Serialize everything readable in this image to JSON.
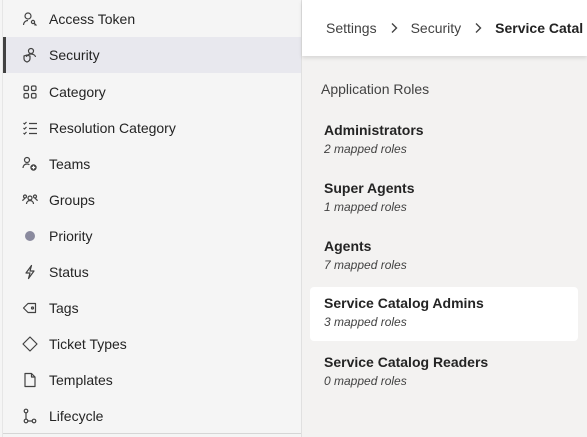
{
  "sidebar": {
    "items": [
      {
        "label": "Access Token",
        "icon": "key-person-icon"
      },
      {
        "label": "Security",
        "icon": "shield-person-icon"
      },
      {
        "label": "Category",
        "icon": "grid-icon"
      },
      {
        "label": "Resolution Category",
        "icon": "checklist-icon"
      },
      {
        "label": "Teams",
        "icon": "team-add-icon"
      },
      {
        "label": "Groups",
        "icon": "people-group-icon"
      },
      {
        "label": "Priority",
        "icon": "priority-dot-icon"
      },
      {
        "label": "Status",
        "icon": "lightning-icon"
      },
      {
        "label": "Tags",
        "icon": "tag-icon"
      },
      {
        "label": "Ticket Types",
        "icon": "diamond-icon"
      },
      {
        "label": "Templates",
        "icon": "document-icon"
      },
      {
        "label": "Lifecycle",
        "icon": "flow-icon"
      }
    ],
    "active_label": "Security"
  },
  "breadcrumb": {
    "items": [
      "Settings",
      "Security",
      "Service Catal"
    ]
  },
  "main": {
    "section_title": "Application Roles",
    "roles": [
      {
        "name": "Administrators",
        "meta": "2 mapped roles"
      },
      {
        "name": "Super Agents",
        "meta": "1 mapped roles"
      },
      {
        "name": "Agents",
        "meta": "7 mapped roles"
      },
      {
        "name": "Service Catalog Admins",
        "meta": "3 mapped roles"
      },
      {
        "name": "Service Catalog Readers",
        "meta": "0 mapped roles"
      }
    ],
    "selected_role": "Service Catalog Admins"
  },
  "colors": {
    "active_indicator": "#424242",
    "priority_dot": "#8a8a9e",
    "page_background": "#f3f2f1"
  }
}
